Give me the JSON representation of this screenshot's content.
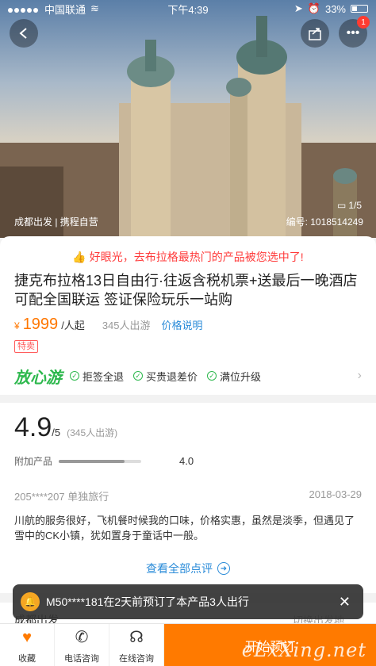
{
  "status": {
    "carrier": "中国联通",
    "time": "下午4:39",
    "battery": "33%"
  },
  "hero": {
    "departure": "成都出发 | 携程自营",
    "code": "编号: 1018514249",
    "image_count": "1/5",
    "notification_count": "1"
  },
  "product": {
    "banner": "好眼光，去布拉格最热门的产品被您选中了!",
    "title": "捷克布拉格13日自由行·往返含税机票+送最后一晚酒店 可配全国联运 签证保险玩乐一站购",
    "price_symbol": "¥",
    "price": "1999",
    "per": "/人起",
    "travelers": "345人出游",
    "price_note": "价格说明",
    "tag": "特卖"
  },
  "assurance": {
    "logo": "放心游",
    "items": [
      "拒签全退",
      "买贵退差价",
      "满位升级"
    ]
  },
  "review": {
    "score": "4.9",
    "score_max": "/5",
    "count": "(345人出游)",
    "sub_label": "附加产品",
    "sub_score": "4.0",
    "sub_fraction": 0.8,
    "user": "205****207 单独旅行",
    "date": "2018-03-29",
    "body": "川航的服务很好，飞机餐时候我的口味，价格实惠，虽然是淡季，但遇见了雪中的CK小镇，犹如置身于童话中一般。",
    "all_link": "查看全部点评"
  },
  "under": {
    "left": "成都出发",
    "right": "切换出发地"
  },
  "toast": {
    "text": "M50****181在2天前预订了本产品3人出行"
  },
  "bottom": {
    "favorite": "收藏",
    "phone": "电话咨询",
    "chat": "在线咨询",
    "book": "开始预订",
    "watermark": "eLxXing.net"
  },
  "colors": {
    "accent": "#ff7a00",
    "link": "#2a8bd8",
    "alert": "#ff3b3b",
    "assure": "#2db84d"
  }
}
